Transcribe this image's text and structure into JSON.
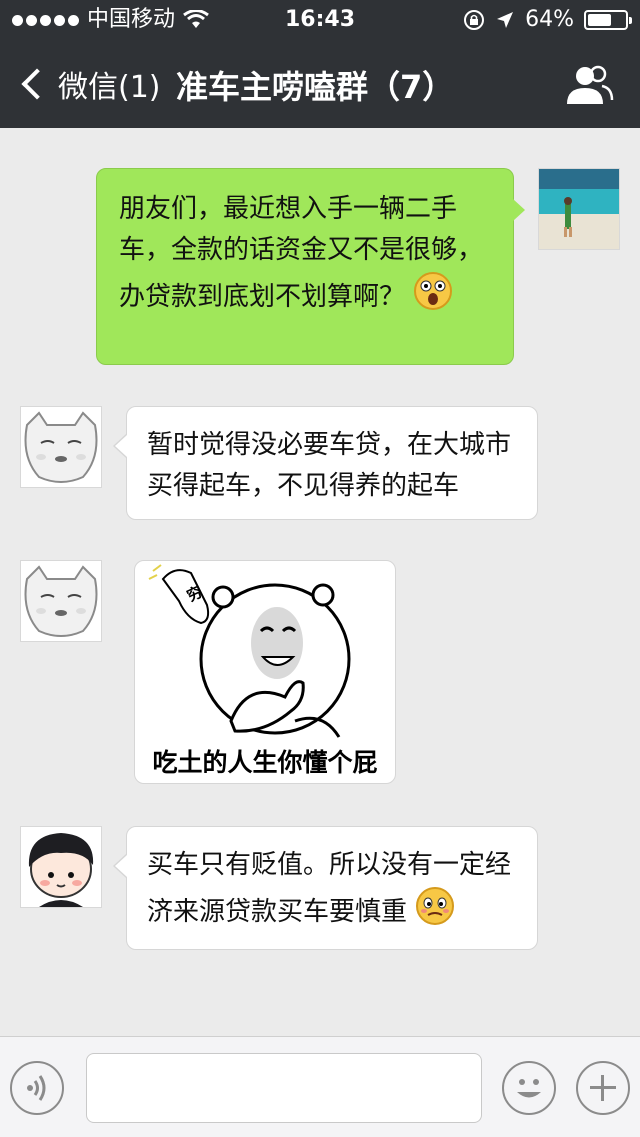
{
  "status_bar": {
    "carrier": "中国移动",
    "time": "16:43",
    "battery_pct": "64%",
    "battery_level": 0.64
  },
  "nav": {
    "back_label": "微信(1)",
    "title": "准车主唠嗑群（7）",
    "people_icon": "group-people-icon"
  },
  "messages": [
    {
      "sender": "self",
      "text": "朋友们，最近想入手一辆二手车，全款的话资金又不是很够，办贷款到底划不划算啊？",
      "emoji": "surprised-emoji"
    },
    {
      "sender": "member1",
      "text": "暂时觉得没必要车贷，在大城市买得起车，不见得养的起车"
    },
    {
      "sender": "member1",
      "image_caption": "吃土的人生你懂个屁",
      "image_label": "穷"
    },
    {
      "sender": "member2",
      "text": "买车只有贬值。所以没有一定经济来源贷款买车要慎重",
      "emoji": "worried-emoji"
    }
  ],
  "input_bar": {
    "voice_icon": "voice-icon",
    "emoji_icon": "emoji-icon",
    "add_icon": "plus-icon",
    "placeholder": ""
  },
  "colors": {
    "topbar": "#2f3236",
    "chat_bg": "#ebebeb",
    "self_bubble": "#a0e75a",
    "other_bubble": "#ffffff"
  }
}
